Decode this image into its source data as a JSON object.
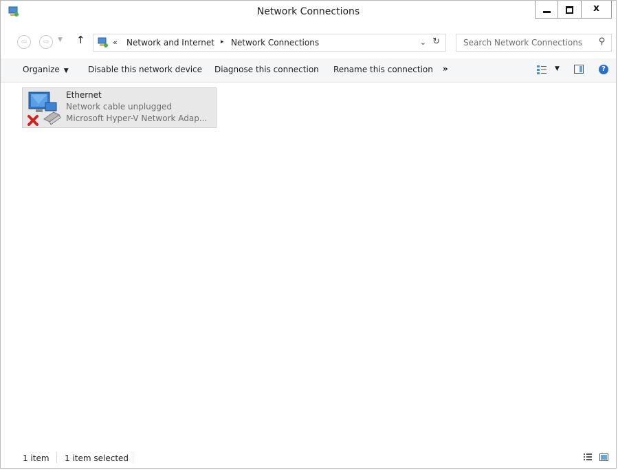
{
  "window": {
    "title": "Network Connections",
    "caption": {
      "minimize_icon": "minimize-icon",
      "maximize_icon": "maximize-icon",
      "close_icon": "close-icon"
    }
  },
  "address": {
    "chevron": "«",
    "crumbs": [
      "Network and Internet",
      "Network Connections"
    ],
    "separator": "▸",
    "dropdown": "⌄",
    "refresh": "↻"
  },
  "search": {
    "placeholder": "Search Network Connections",
    "icon": "search-icon"
  },
  "nav": {
    "back": "⇦",
    "forward": "⇨",
    "dropdown": "▼",
    "up": "↑"
  },
  "toolbar": {
    "organize": "Organize",
    "disable": "Disable this network device",
    "diagnose": "Diagnose this connection",
    "rename": "Rename this connection",
    "more": "»",
    "caret": "▼",
    "help": "?"
  },
  "items": [
    {
      "name": "Ethernet",
      "status": "Network cable unplugged",
      "adapter": "Microsoft Hyper-V Network Adap...",
      "icon": "network-adapter-disconnected-icon"
    }
  ],
  "statusbar": {
    "count": "1 item",
    "selected": "1 item selected"
  },
  "colors": {
    "accent": "#2a6fc9",
    "toolbar_bg": "#f5f6f7",
    "selected_tile": "#e8e8e8",
    "error_red": "#d32020"
  }
}
